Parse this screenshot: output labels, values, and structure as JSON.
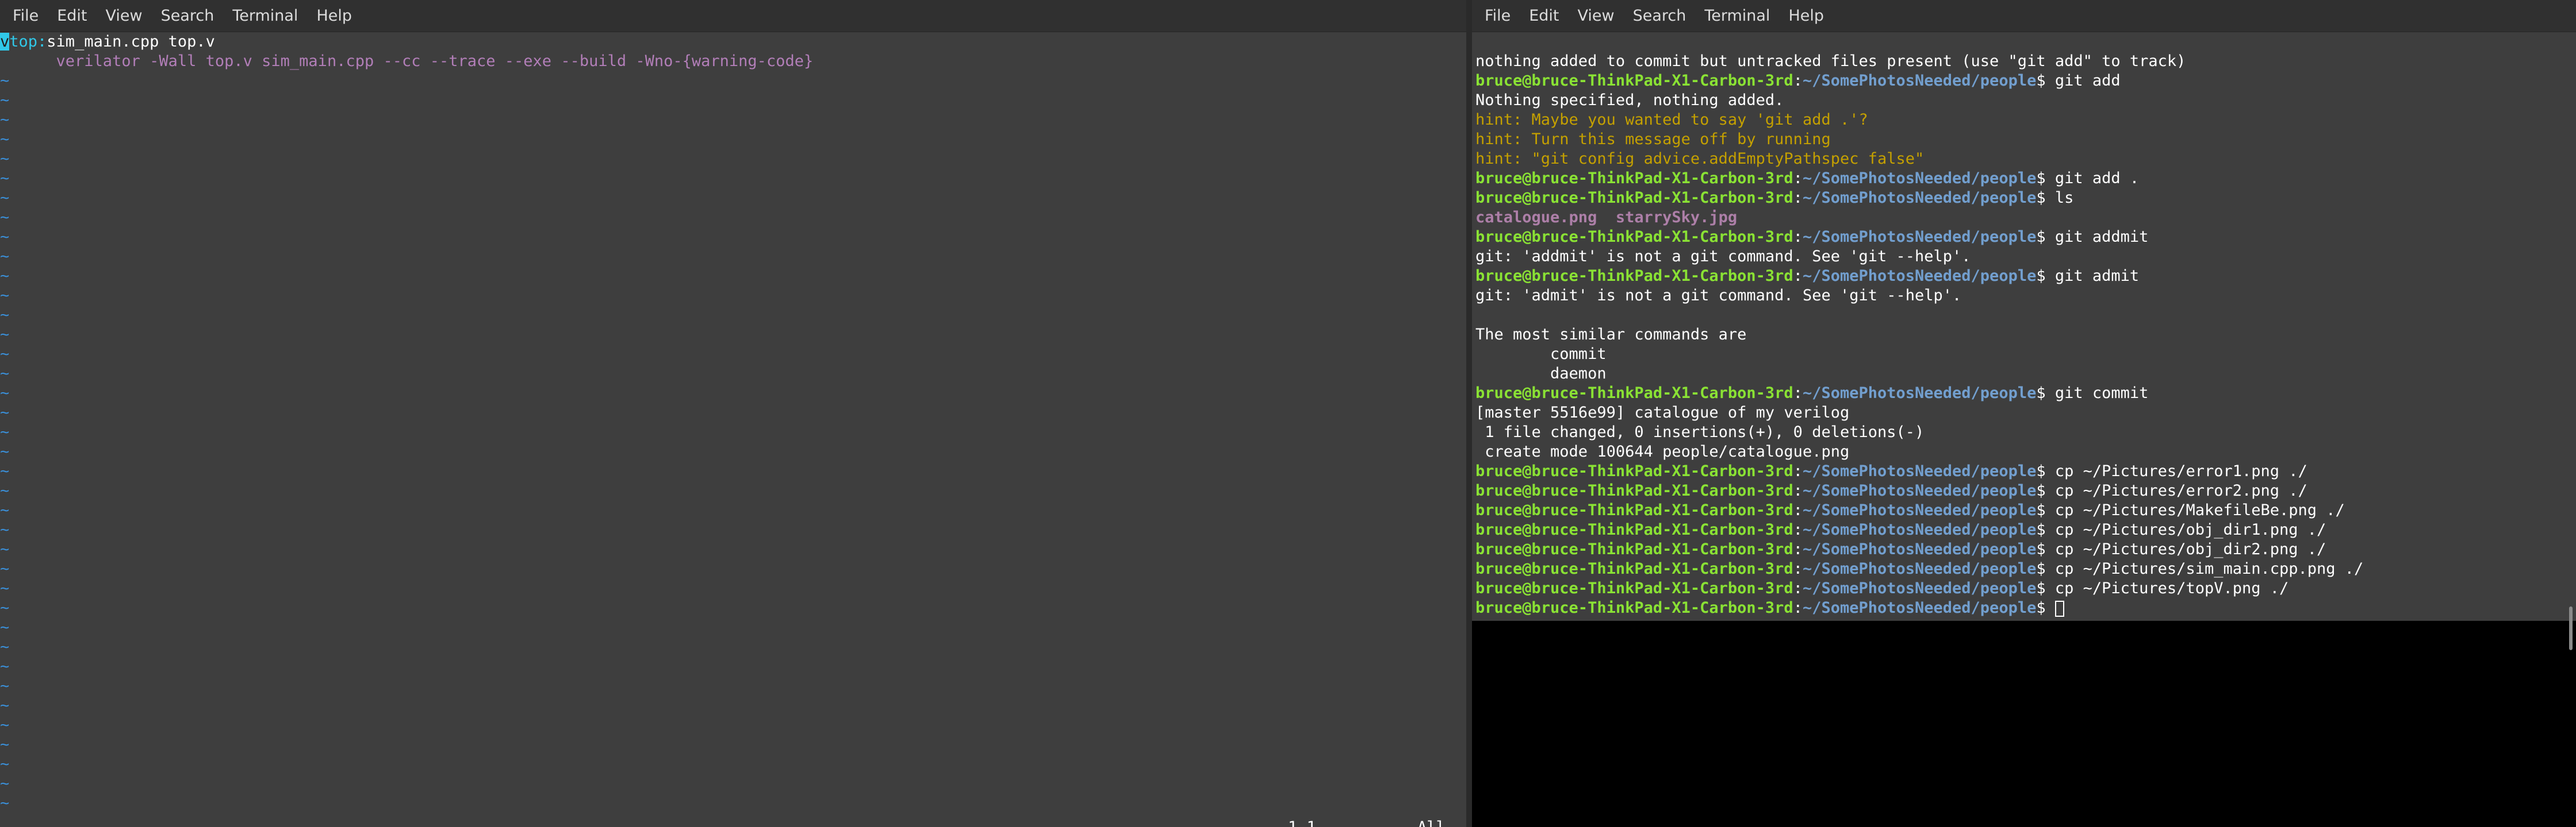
{
  "left_window": {
    "menu": [
      "File",
      "Edit",
      "View",
      "Search",
      "Terminal",
      "Help"
    ],
    "vim": {
      "cursor_char": "v",
      "top_label": "top:",
      "line1_rest": "sim_main.cpp top.v",
      "line2": "      verilator -Wall top.v sim_main.cpp --cc --trace --exe --build -Wno-{warning-code}",
      "tilde": "~",
      "position": "1,1",
      "scroll": "All"
    }
  },
  "right_window": {
    "menu": [
      "File",
      "Edit",
      "View",
      "Search",
      "Terminal",
      "Help"
    ],
    "prompt": {
      "userhost": "bruce@bruce-ThinkPad-X1-Carbon-3rd",
      "colon": ":",
      "path": "~/SomePhotosNeeded/people",
      "dollar": "$"
    },
    "lines": [
      {
        "type": "text",
        "text": "nothing added to commit but untracked files present (use \"git add\" to track)"
      },
      {
        "type": "prompt",
        "cmd": " git add"
      },
      {
        "type": "text",
        "text": "Nothing specified, nothing added."
      },
      {
        "type": "hint",
        "text": "hint: Maybe you wanted to say 'git add .'?"
      },
      {
        "type": "hint",
        "text": "hint: Turn this message off by running"
      },
      {
        "type": "hint",
        "text": "hint: \"git config advice.addEmptyPathspec false\""
      },
      {
        "type": "prompt",
        "cmd": " git add ."
      },
      {
        "type": "prompt",
        "cmd": " ls"
      },
      {
        "type": "ls",
        "text": "catalogue.png  starrySky.jpg"
      },
      {
        "type": "prompt",
        "cmd": " git addmit"
      },
      {
        "type": "text",
        "text": "git: 'addmit' is not a git command. See 'git --help'."
      },
      {
        "type": "prompt",
        "cmd": " git admit"
      },
      {
        "type": "text",
        "text": "git: 'admit' is not a git command. See 'git --help'."
      },
      {
        "type": "text",
        "text": ""
      },
      {
        "type": "text",
        "text": "The most similar commands are"
      },
      {
        "type": "text",
        "text": "        commit"
      },
      {
        "type": "text",
        "text": "        daemon"
      },
      {
        "type": "prompt",
        "cmd": " git commit"
      },
      {
        "type": "text",
        "text": "[master 5516e99] catalogue of my verilog"
      },
      {
        "type": "text",
        "text": " 1 file changed, 0 insertions(+), 0 deletions(-)"
      },
      {
        "type": "text",
        "text": " create mode 100644 people/catalogue.png"
      },
      {
        "type": "prompt",
        "cmd": " cp ~/Pictures/error1.png ./"
      },
      {
        "type": "prompt",
        "cmd": " cp ~/Pictures/error2.png ./"
      },
      {
        "type": "prompt",
        "cmd": " cp ~/Pictures/MakefileBe.png ./"
      },
      {
        "type": "prompt",
        "cmd": " cp ~/Pictures/obj_dir1.png ./"
      },
      {
        "type": "prompt",
        "cmd": " cp ~/Pictures/obj_dir2.png ./"
      },
      {
        "type": "prompt",
        "cmd": " cp ~/Pictures/sim_main.cpp.png ./"
      },
      {
        "type": "prompt",
        "cmd": " cp ~/Pictures/topV.png ./"
      },
      {
        "type": "prompt",
        "cmd": " ",
        "cursor": true
      }
    ]
  }
}
